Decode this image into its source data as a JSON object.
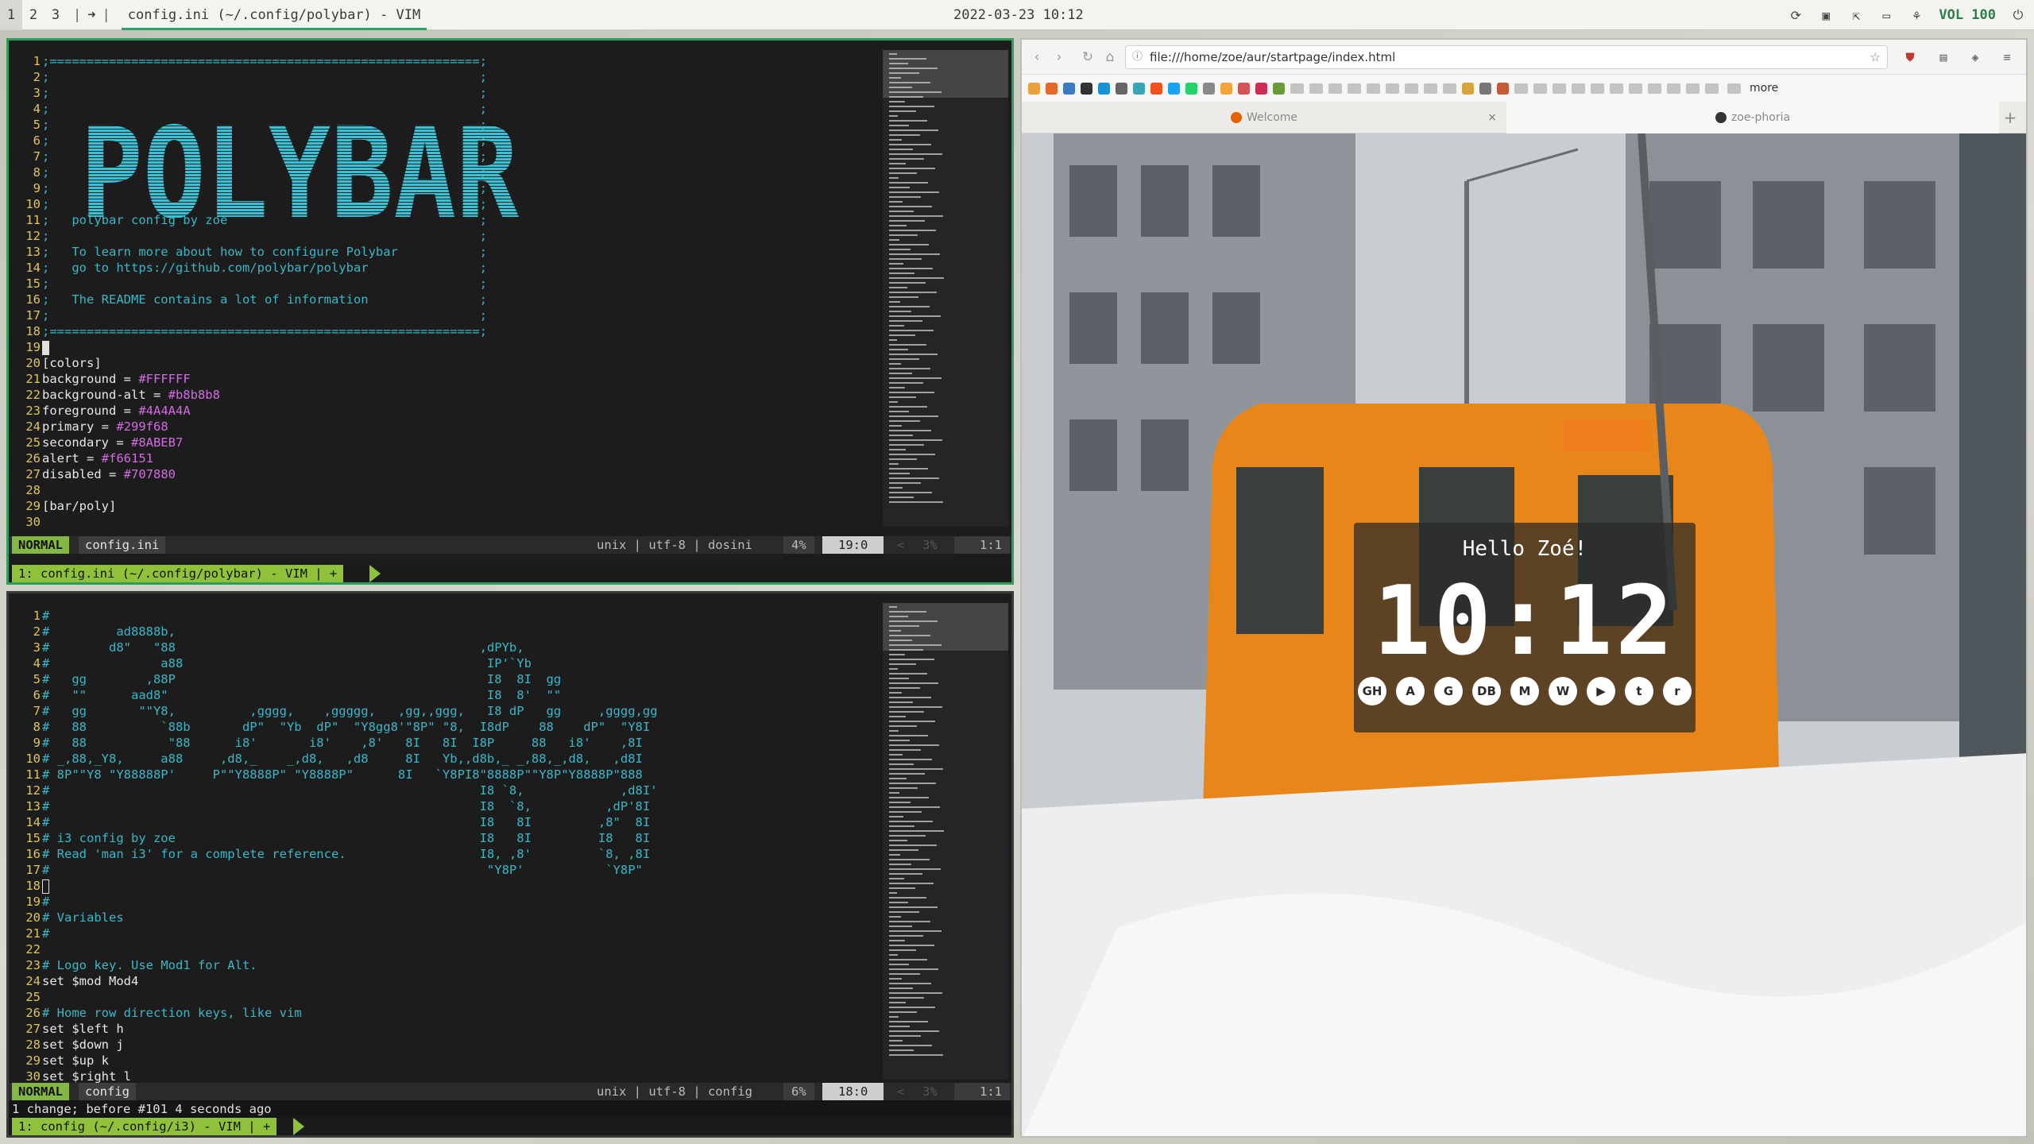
{
  "topbar": {
    "workspaces": [
      "1",
      "2",
      "3"
    ],
    "separator_left": "|",
    "arrow": "➜",
    "separator_right": "|",
    "window_title": "config.ini (~/.config/polybar) - VIM",
    "datetime": "2022-03-23 10:12",
    "tray_icons": [
      "refresh-icon",
      "clipboard-icon",
      "external-link-icon",
      "monitor-icon",
      "network-icon"
    ],
    "volume_label": "VOL 100",
    "power_icon": "power-icon"
  },
  "vim_top": {
    "lines": [
      {
        "n": "1",
        "t": ";==========================================================;",
        "c": "c-com"
      },
      {
        "n": "2",
        "t": ";                                                          ;",
        "c": "c-com"
      },
      {
        "n": "3",
        "t": ";                                                          ;",
        "c": "c-com"
      },
      {
        "n": "4",
        "t": ";                                                          ;",
        "c": "c-com"
      },
      {
        "n": "5",
        "t": ";                                                          ;",
        "c": "c-com"
      },
      {
        "n": "6",
        "t": ";                                                          ;",
        "c": "c-com"
      },
      {
        "n": "7",
        "t": ";                                                          ;",
        "c": "c-com"
      },
      {
        "n": "8",
        "t": ";                                                          ;",
        "c": "c-com"
      },
      {
        "n": "9",
        "t": ";                                                          ;",
        "c": "c-com"
      },
      {
        "n": "10",
        "t": ";                                                          ;",
        "c": "c-com"
      },
      {
        "n": "11",
        "t": ";   polybar config by zoe                                  ;",
        "c": "c-com"
      },
      {
        "n": "12",
        "t": ";                                                          ;",
        "c": "c-com"
      },
      {
        "n": "13",
        "t": ";   To learn more about how to configure Polybar           ;",
        "c": "c-com"
      },
      {
        "n": "14",
        "t": ";   go to https://github.com/polybar/polybar               ;",
        "c": "c-com"
      },
      {
        "n": "15",
        "t": ";                                                          ;",
        "c": "c-com"
      },
      {
        "n": "16",
        "t": ";   The README contains a lot of information               ;",
        "c": "c-com"
      },
      {
        "n": "17",
        "t": ";                                                          ;",
        "c": "c-com"
      },
      {
        "n": "18",
        "t": ";==========================================================;",
        "c": "c-com"
      },
      {
        "n": "19",
        "t": "",
        "c": "cursor"
      },
      {
        "n": "20",
        "t": "[colors]",
        "c": "c-sec"
      },
      {
        "n": "21",
        "k": "background = ",
        "v": "#FFFFFF",
        "c": "kv"
      },
      {
        "n": "22",
        "k": "background-alt = ",
        "v": "#b8b8b8",
        "c": "kv"
      },
      {
        "n": "23",
        "k": "foreground = ",
        "v": "#4A4A4A",
        "c": "kv"
      },
      {
        "n": "24",
        "k": "primary = ",
        "v": "#299f68",
        "c": "kv"
      },
      {
        "n": "25",
        "k": "secondary = ",
        "v": "#8ABEB7",
        "c": "kv"
      },
      {
        "n": "26",
        "k": "alert = ",
        "v": "#f66151",
        "c": "kv"
      },
      {
        "n": "27",
        "k": "disabled = ",
        "v": "#707880",
        "c": "kv"
      },
      {
        "n": "28",
        "t": "",
        "c": "c-plain"
      },
      {
        "n": "29",
        "t": "[bar/poly]",
        "c": "c-sec"
      },
      {
        "n": "30",
        "t": "",
        "c": "c-plain"
      }
    ],
    "logo_text": "POLYBAR",
    "status": {
      "mode": "NORMAL",
      "filename": "config.ini",
      "info": "unix | utf-8 | dosini",
      "percent": "4%",
      "position": "19:0",
      "mm_arrow": "<",
      "mm_percent": "3%",
      "mm_pos": "1:1"
    },
    "tabline": "1: config.ini (~/.config/polybar) - VIM | +"
  },
  "vim_bottom": {
    "lines": [
      {
        "n": "1",
        "t": "#"
      },
      {
        "n": "2",
        "t": "#         ad8888b,"
      },
      {
        "n": "3",
        "t": "#        d8\"   \"88                                         ,dPYb,"
      },
      {
        "n": "4",
        "t": "#               a88                                         IP'`Yb"
      },
      {
        "n": "5",
        "t": "#   gg        ,88P                                          I8  8I  gg"
      },
      {
        "n": "6",
        "t": "#   \"\"      aad8\"                                           I8  8'  \"\""
      },
      {
        "n": "7",
        "t": "#   gg       \"\"Y8,          ,gggg,    ,ggggg,   ,gg,,ggg,   I8 dP   gg     ,gggg,gg"
      },
      {
        "n": "8",
        "t": "#   88          `88b       dP\"  \"Yb  dP\"  \"Y8gg8'\"8P\" \"8,  I8dP    88    dP\"  \"Y8I"
      },
      {
        "n": "9",
        "t": "#   88           \"88      i8'       i8'    ,8'   8I   8I  I8P     88   i8'    ,8I"
      },
      {
        "n": "10",
        "t": "# _,88,_Y8,     a88     ,d8,_    _,d8,   ,d8     8I   Yb,,d8b,_ _,88,_,d8,   ,d8I"
      },
      {
        "n": "11",
        "t": "# 8P\"\"Y8 \"Y88888P'     P\"\"Y8888P\" \"Y8888P\"      8I   `Y8PI8\"8888P\"\"Y8P\"Y8888P\"888"
      },
      {
        "n": "12",
        "t": "#                                                          I8 `8,             ,d8I'"
      },
      {
        "n": "13",
        "t": "#                                                          I8  `8,          ,dP'8I"
      },
      {
        "n": "14",
        "t": "#                                                          I8   8I         ,8\"  8I"
      },
      {
        "n": "15",
        "t": "# i3 config by zoe                                         I8   8I         I8   8I"
      },
      {
        "n": "16",
        "t": "# Read 'man i3' for a complete reference.                  I8, ,8'         `8, ,8I"
      },
      {
        "n": "17",
        "t": "#                                                           \"Y8P'           `Y8P\""
      },
      {
        "n": "18",
        "t": "",
        "cur": true
      },
      {
        "n": "19",
        "t": "#"
      },
      {
        "n": "20",
        "t": "# Variables"
      },
      {
        "n": "21",
        "t": "#"
      },
      {
        "n": "22",
        "t": ""
      },
      {
        "n": "23",
        "t": "# Logo key. Use Mod1 for Alt."
      },
      {
        "n": "24",
        "t": "set $mod Mod4",
        "plain": true
      },
      {
        "n": "25",
        "t": ""
      },
      {
        "n": "26",
        "t": "# Home row direction keys, like vim"
      },
      {
        "n": "27",
        "t": "set $left h",
        "plain": true
      },
      {
        "n": "28",
        "t": "set $down j",
        "plain": true
      },
      {
        "n": "29",
        "t": "set $up k",
        "plain": true
      },
      {
        "n": "30",
        "t": "set $right l",
        "plain": true
      }
    ],
    "status": {
      "mode": "NORMAL",
      "filename": "config",
      "info": "unix | utf-8 | config",
      "percent": "6%",
      "position": "18:0",
      "mm_arrow": "<",
      "mm_percent": "3%",
      "mm_pos": "1:1"
    },
    "cmdline": "1 change; before #101  4 seconds ago",
    "tabline": "1: config (~/.config/i3) - VIM | +"
  },
  "browser": {
    "url": "file:///home/zoe/aur/startpage/index.html",
    "bookmarks_more": "more",
    "tabs": [
      {
        "label": "Welcome",
        "close": "×"
      },
      {
        "label": "zoe-phoria"
      }
    ],
    "newtab": "+",
    "startpage": {
      "greeting": "Hello Zoé!",
      "time": "10:12",
      "links": [
        {
          "icon": "github-icon",
          "glyph": "GH"
        },
        {
          "icon": "aur-icon",
          "glyph": "A"
        },
        {
          "icon": "gnome-icon",
          "glyph": "G"
        },
        {
          "icon": "database-icon",
          "glyph": "DB"
        },
        {
          "icon": "map-pin-icon",
          "glyph": "M"
        },
        {
          "icon": "whatsapp-icon",
          "glyph": "W"
        },
        {
          "icon": "youtube-icon",
          "glyph": "▶"
        },
        {
          "icon": "twitter-icon",
          "glyph": "t"
        },
        {
          "icon": "reddit-icon",
          "glyph": "r"
        }
      ]
    }
  },
  "colors": {
    "vim_green": "#2e9e5a",
    "mode_green": "#84b844",
    "comment_cyan": "#39b7c7",
    "hex_magenta": "#d26be3",
    "logo_cyan": "#35c3d8",
    "tram_orange": "#e8861a"
  }
}
